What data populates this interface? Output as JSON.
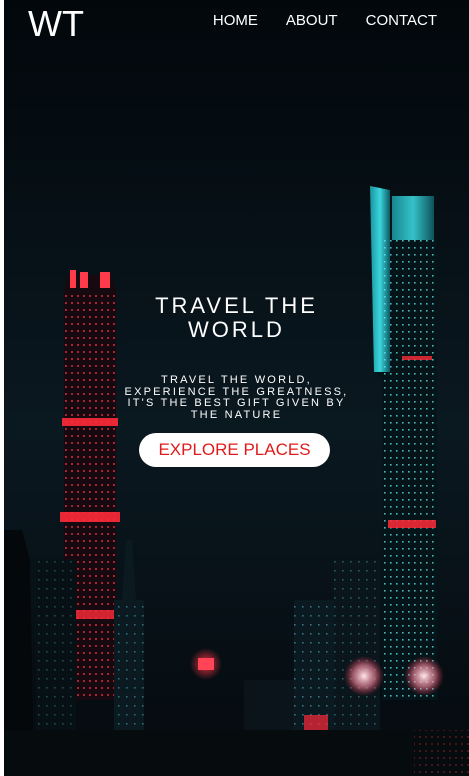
{
  "nav": {
    "logo": "WT",
    "links": [
      "HOME",
      "ABOUT",
      "CONTACT"
    ]
  },
  "hero": {
    "title": "TRAVEL THE WORLD",
    "subtitle": "TRAVEL THE WORLD, EXPERIENCE THE GREATNESS, IT'S THE BEST GIFT GIVEN BY THE NATURE",
    "cta_label": "EXPLORE PLACES",
    "background_image": "night-city-skyline"
  },
  "colors": {
    "cta_text": "#e01b1b",
    "cta_background": "#ffffff",
    "text": "#ffffff",
    "tower_cyan": "#3fe0e8",
    "tower_red": "#ff2a3a"
  }
}
